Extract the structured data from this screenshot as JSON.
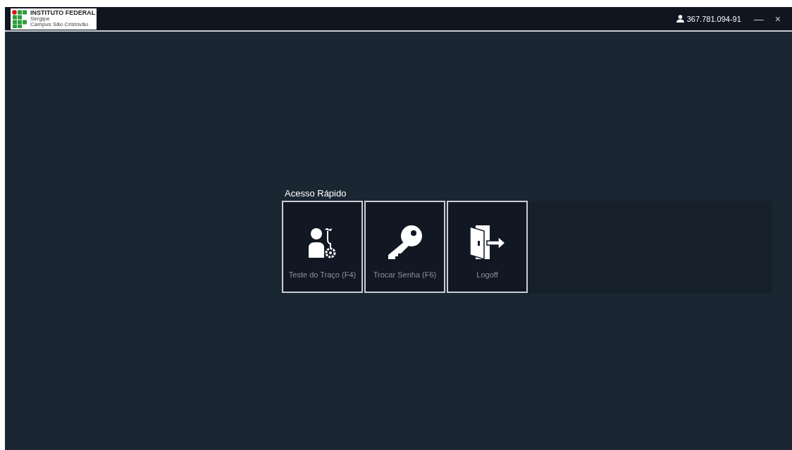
{
  "logo": {
    "name": "INSTITUTO FEDERAL",
    "state": "Sergipe",
    "campus": "Campus São Cristóvão"
  },
  "user": {
    "id": "367.781.094-91"
  },
  "window_controls": [
    "—",
    "×"
  ],
  "quick_access": {
    "title": "Acesso Rápido",
    "tiles": [
      {
        "label": "Teste do Traço (F4)"
      },
      {
        "label": "Trocar Senha (F6)"
      },
      {
        "label": "Logoff"
      }
    ]
  }
}
